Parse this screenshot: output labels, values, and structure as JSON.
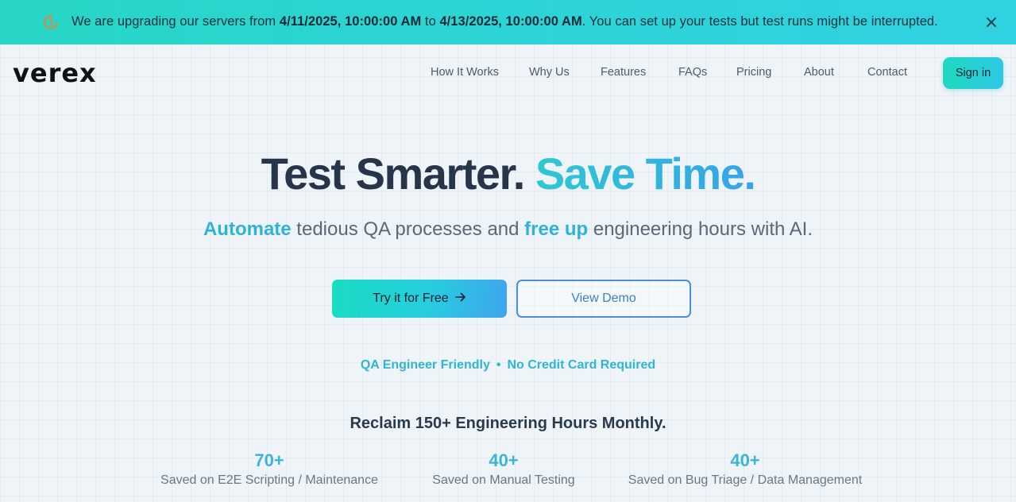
{
  "banner": {
    "prefix": "We are upgrading our servers from ",
    "start": "4/11/2025, 10:00:00 AM",
    "middle": " to ",
    "end": "4/13/2025, 10:00:00 AM",
    "suffix": ". You can set up your tests but test runs might be interrupted.",
    "icon": "clock-icon",
    "close_icon": "close-icon"
  },
  "logo": "verex",
  "nav": [
    {
      "label": "How It Works"
    },
    {
      "label": "Why Us"
    },
    {
      "label": "Features"
    },
    {
      "label": "FAQs"
    },
    {
      "label": "Pricing"
    },
    {
      "label": "About"
    },
    {
      "label": "Contact"
    }
  ],
  "signin_label": "Sign in",
  "hero": {
    "title_part1": "Test Smarter.",
    "title_part2": "Save Time.",
    "subtitle_hl1": "Automate",
    "subtitle_mid": " tedious QA processes and ",
    "subtitle_hl2": "free up",
    "subtitle_end": " engineering hours with AI."
  },
  "buttons": {
    "try_free": "Try it for Free",
    "try_free_icon": "arrow-right-icon",
    "view_demo": "View Demo"
  },
  "tagline": {
    "left": "QA Engineer Friendly",
    "sep": "•",
    "right": "No Credit Card Required"
  },
  "reclaim": "Reclaim 150+ Engineering Hours Monthly.",
  "stats": [
    {
      "value": "70+",
      "label": "Saved on E2E Scripting / Maintenance"
    },
    {
      "value": "40+",
      "label": "Saved on Manual Testing"
    },
    {
      "value": "40+",
      "label": "Saved on Bug Triage / Data Management"
    }
  ],
  "colors": {
    "banner": "#2ed3d8",
    "accent": "#2fb2d8",
    "demo_border": "#4a8fd6",
    "title": "#26354a"
  }
}
